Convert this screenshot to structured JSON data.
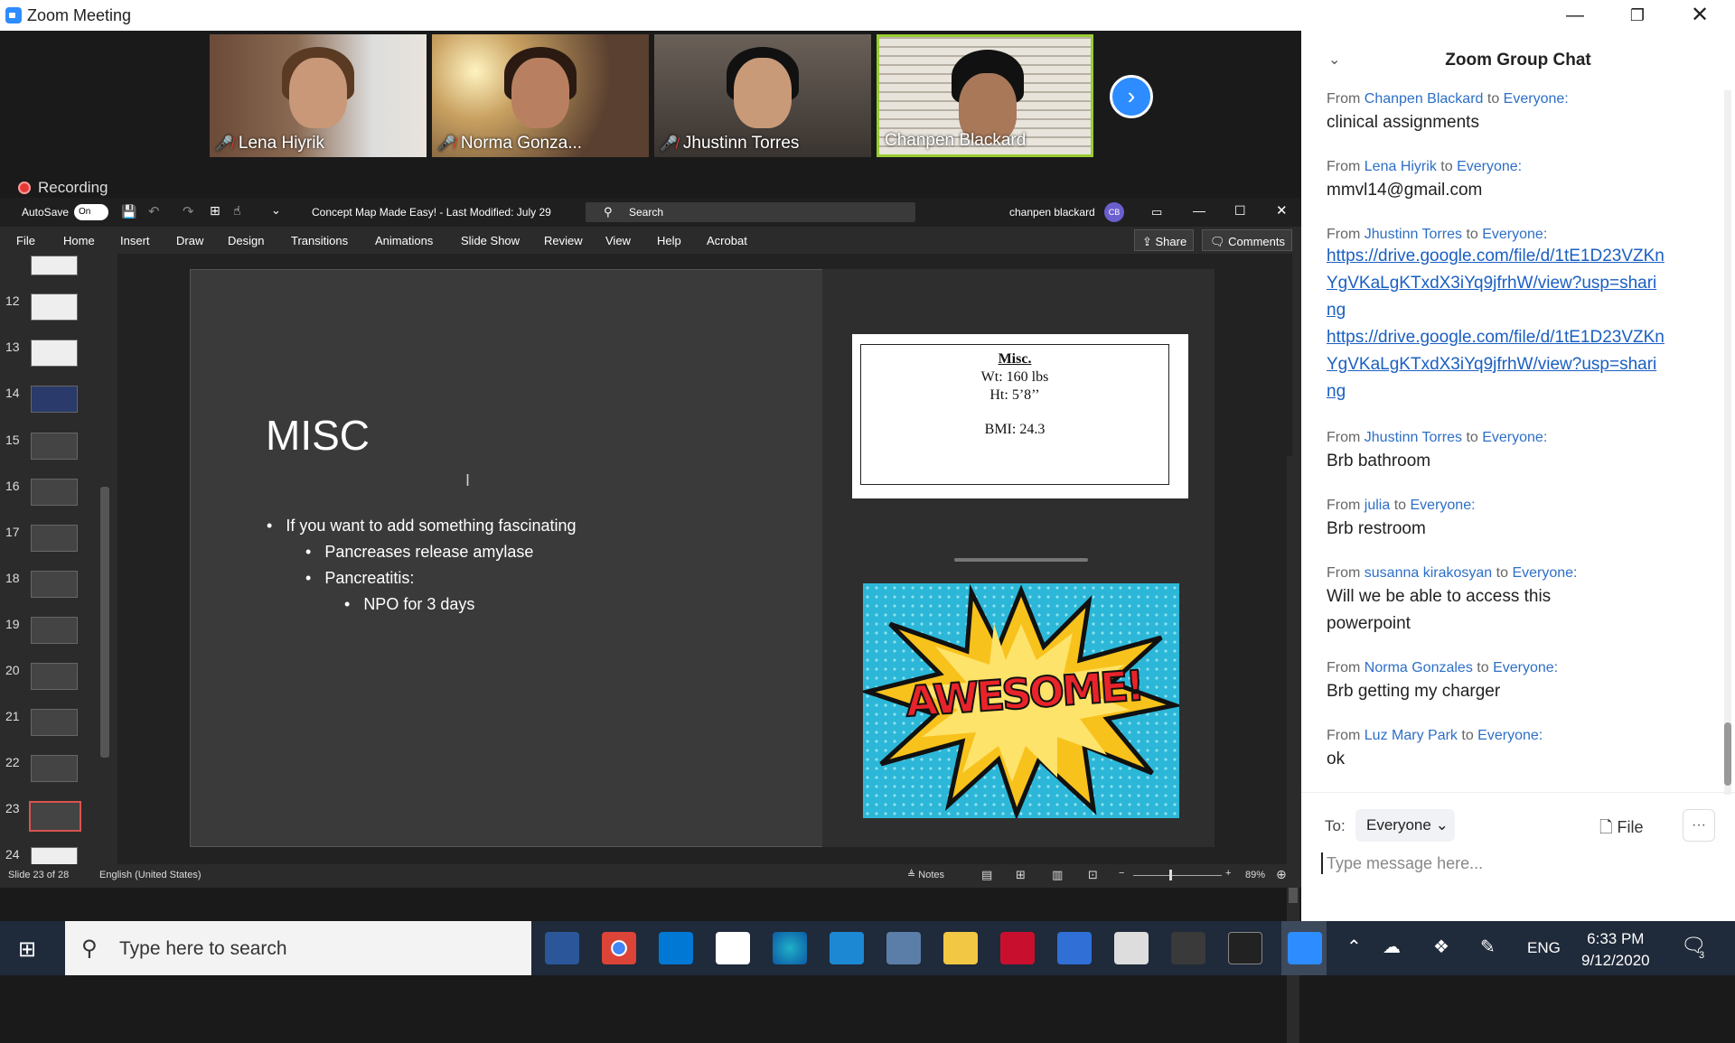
{
  "zoom": {
    "window_title": "Zoom Meeting",
    "participants": [
      {
        "name": "Lena Hiyrik",
        "muted": true
      },
      {
        "name": "Norma Gonza...",
        "muted": true
      },
      {
        "name": "Jhustinn Torres",
        "muted": true
      },
      {
        "name": "Chanpen Blackard",
        "muted": false
      }
    ],
    "recording_label": "Recording",
    "next_icon": "chevron-right-icon"
  },
  "ppt": {
    "autosave_label": "AutoSave",
    "autosave_state": "On",
    "doc_title": "Concept Map Made Easy!  -  Last Modified: July 29",
    "search_placeholder": "Search",
    "user_name": "chanpen blackard",
    "user_initials": "CB",
    "tabs": [
      "File",
      "Home",
      "Insert",
      "Draw",
      "Design",
      "Transitions",
      "Animations",
      "Slide Show",
      "Review",
      "View",
      "Help",
      "Acrobat"
    ],
    "share_label": "Share",
    "comments_label": "Comments",
    "thumb_numbers": [
      "12",
      "13",
      "14",
      "15",
      "16",
      "17",
      "18",
      "19",
      "20",
      "21",
      "22",
      "23",
      "24"
    ],
    "slide": {
      "title": "MISC",
      "bullets": [
        "If you want to add something fascinating",
        "Pancreases release amylase",
        "Pancreatitis:",
        "NPO for 3 days"
      ],
      "misc_box": {
        "heading": "Misc.",
        "wt": "Wt: 160 lbs",
        "ht": "Ht: 5’8’’",
        "bmi": "BMI: 24.3"
      },
      "image_text": "AWESOME!"
    },
    "status": {
      "slide_count": "Slide 23 of 28",
      "language": "English (United States)",
      "notes_label": "Notes",
      "zoom": "89%"
    }
  },
  "chat": {
    "title": "Zoom Group Chat",
    "messages": [
      {
        "from": "Chanpen Blackard",
        "to": "Everyone:",
        "text": "clinical assignments"
      },
      {
        "from": "Lena Hiyrik",
        "to": "Everyone:",
        "text": "mmvl14@gmail.com"
      },
      {
        "from": "Jhustinn Torres",
        "to": "Everyone:",
        "links": [
          "https://drive.google.com/file/d/1tE1D23VZKnYgVKaLgKTxdX3iYq9jfrhW/view?usp=sharing",
          "https://drive.google.com/file/d/1tE1D23VZKnYgVKaLgKTxdX3iYq9jfrhW/view?usp=sharing"
        ]
      },
      {
        "from": "Jhustinn Torres",
        "to": "Everyone:",
        "text": "Brb bathroom"
      },
      {
        "from": "julia",
        "to": "Everyone:",
        "text": "Brb restroom"
      },
      {
        "from": "susanna kirakosyan",
        "to": "Everyone:",
        "text": "Will we be able to access this powerpoint"
      },
      {
        "from": "Norma Gonzales",
        "to": "Everyone:",
        "text": "Brb getting my charger"
      },
      {
        "from": "Luz Mary Park",
        "to": "Everyone:",
        "text": "ok"
      }
    ],
    "from_word": "From",
    "to_word": "to",
    "to_label": "To:",
    "recipient": "Everyone",
    "file_label": "File",
    "input_placeholder": "Type message here..."
  },
  "taskbar": {
    "search_placeholder": "Type here to search",
    "language": "ENG",
    "time": "6:33 PM",
    "date": "9/12/2020",
    "notifications": "3"
  }
}
